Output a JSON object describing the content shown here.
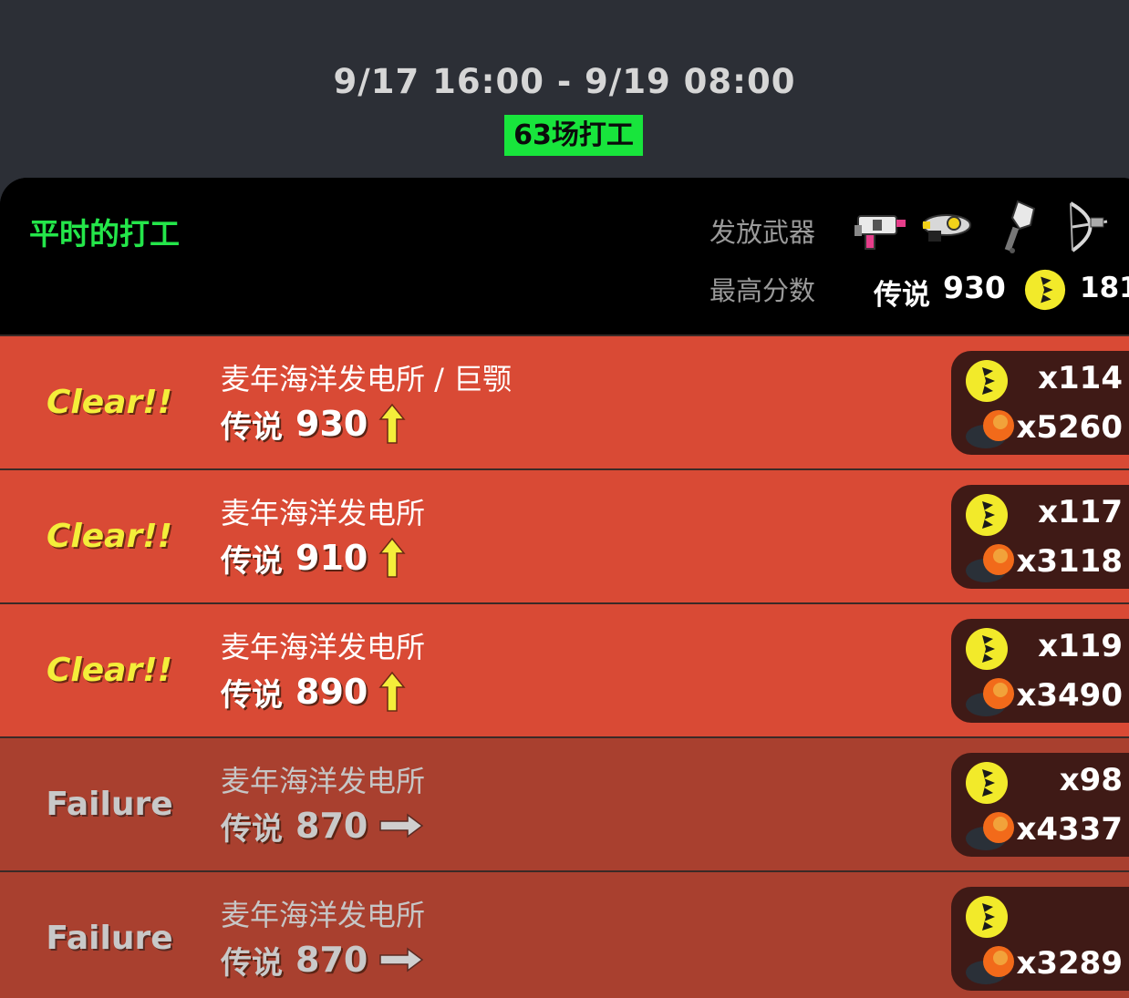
{
  "header": {
    "date_range": "9/17 16:00 - 9/19 08:00",
    "shift_count": "63场打工"
  },
  "summary": {
    "title": "平时的打工",
    "weapons_label": "发放武器",
    "best_label": "最高分数",
    "best_rank": "传说",
    "best_score": "930",
    "best_golden_eggs": "181",
    "weapons": [
      "splattershot-weapon-icon",
      "blaster-weapon-icon",
      "brush-weapon-icon",
      "bow-weapon-icon"
    ]
  },
  "shifts": [
    {
      "status": "Clear!!",
      "stage": "麦年海洋发电所 / 巨颚",
      "rank": "传说",
      "score": "930",
      "trend": "up",
      "golden_eggs": "x114",
      "power_eggs": "x5260"
    },
    {
      "status": "Clear!!",
      "stage": "麦年海洋发电所",
      "rank": "传说",
      "score": "910",
      "trend": "up",
      "golden_eggs": "x117",
      "power_eggs": "x3118"
    },
    {
      "status": "Clear!!",
      "stage": "麦年海洋发电所",
      "rank": "传说",
      "score": "890",
      "trend": "up",
      "golden_eggs": "x119",
      "power_eggs": "x3490"
    },
    {
      "status": "Failure",
      "stage": "麦年海洋发电所",
      "rank": "传说",
      "score": "870",
      "trend": "flat",
      "golden_eggs": "x98",
      "power_eggs": "x4337"
    },
    {
      "status": "Failure",
      "stage": "麦年海洋发电所",
      "rank": "传说",
      "score": "870",
      "trend": "flat",
      "golden_eggs": "",
      "power_eggs": "x3289"
    }
  ],
  "colors": {
    "accent_green": "#24e64a",
    "clear_row": "#d94a35",
    "fail_row": "#a9402f",
    "clear_text": "#f4ee3a",
    "golden_egg": "#f2ea2a"
  }
}
